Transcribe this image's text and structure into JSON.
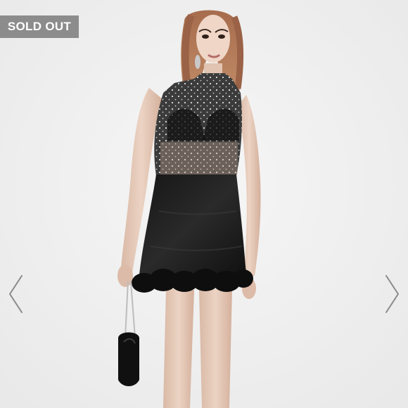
{
  "badge": {
    "label": "SOLD OUT"
  },
  "carousel": {
    "prev_icon": "chevron-left-icon",
    "next_icon": "chevron-right-icon"
  },
  "photo": {
    "subject": "product-photo"
  },
  "colors": {
    "background": "#efefef",
    "badge": "#8c8c8c",
    "badge_text": "#ffffff",
    "arrow": "#8a8a8a"
  }
}
